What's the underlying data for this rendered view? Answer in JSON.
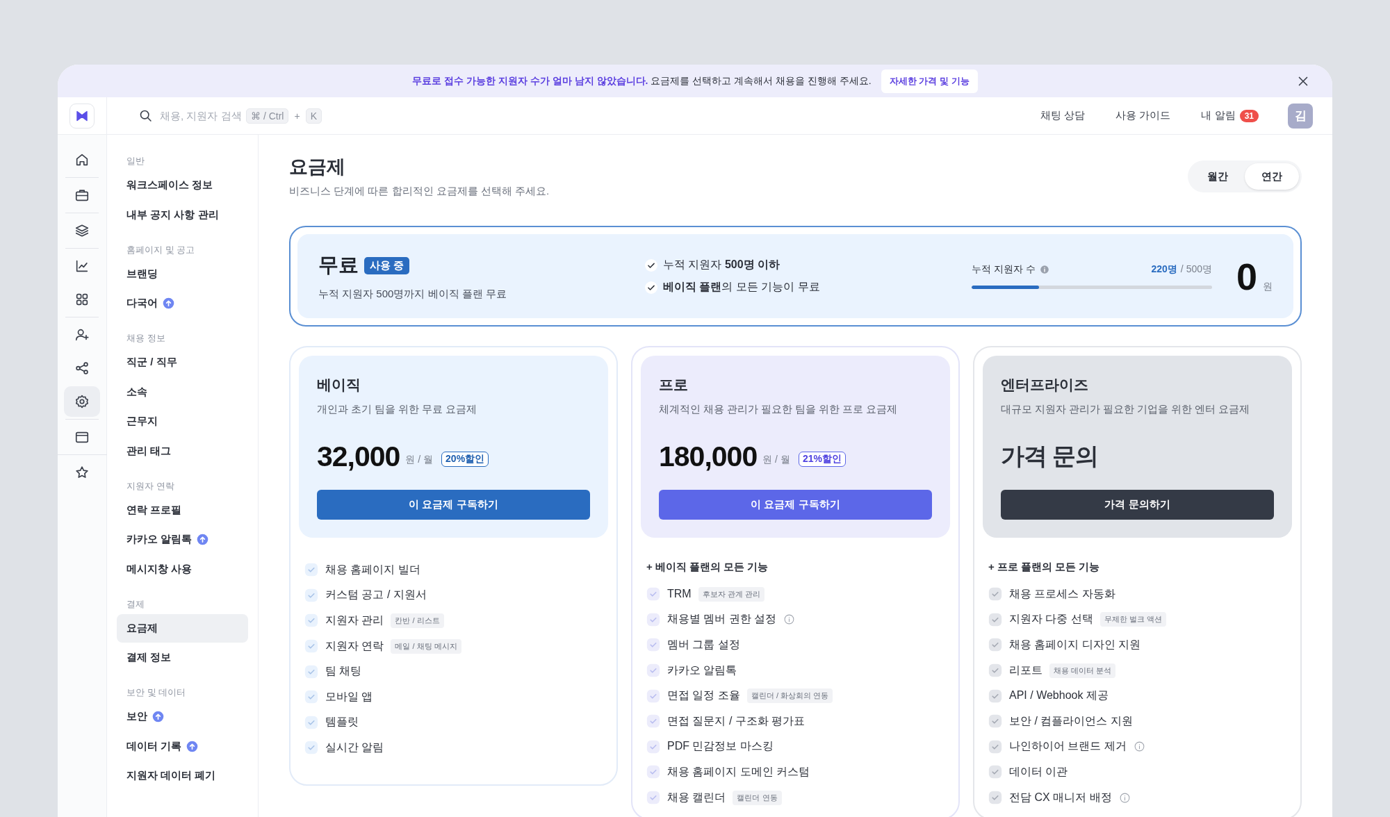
{
  "banner": {
    "message": "**무료로 접수 가능한 지원자 수가 얼마 남지 않았습니다.** 요금제를 선택하고 계속해서 채용을 진행해 주세요.",
    "link": "자세한 가격 및 기능"
  },
  "topbar": {
    "search": {
      "placeholder": "채용, 지원자 검색",
      "keys": [
        "⌘ / Ctrl",
        "K"
      ],
      "joiner": "+"
    },
    "links": [
      {
        "label": "채팅 상담"
      },
      {
        "label": "사용 가이드"
      },
      {
        "label": "내 알림",
        "badge": "31"
      }
    ],
    "avatar": "김"
  },
  "rail": [
    [
      {
        "kind": "home",
        "selected": false
      }
    ],
    [
      {
        "kind": "briefcase",
        "selected": false
      }
    ],
    [
      {
        "kind": "layers",
        "selected": false
      }
    ],
    [
      {
        "kind": "chart",
        "selected": false
      },
      {
        "kind": "grid",
        "selected": false
      }
    ],
    [
      {
        "kind": "user-plus",
        "selected": false
      },
      {
        "kind": "share",
        "selected": false
      },
      {
        "kind": "settings",
        "selected": true
      }
    ],
    [
      {
        "kind": "window",
        "selected": false
      }
    ],
    [
      {
        "kind": "star",
        "selected": false
      }
    ]
  ],
  "sidebar": [
    {
      "title": "일반",
      "items": [
        {
          "label": "워크스페이스 정보",
          "selected": false,
          "upgrade": false
        },
        {
          "label": "내부 공지 사항 관리",
          "selected": false,
          "upgrade": false
        }
      ]
    },
    {
      "title": "홈페이지 및 공고",
      "items": [
        {
          "label": "브랜딩",
          "selected": false,
          "upgrade": false
        },
        {
          "label": "다국어",
          "selected": false,
          "upgrade": true
        }
      ]
    },
    {
      "title": "채용 정보",
      "items": [
        {
          "label": "직군 / 직무",
          "selected": false,
          "upgrade": false
        },
        {
          "label": "소속",
          "selected": false,
          "upgrade": false
        },
        {
          "label": "근무지",
          "selected": false,
          "upgrade": false
        },
        {
          "label": "관리 태그",
          "selected": false,
          "upgrade": false
        }
      ]
    },
    {
      "title": "지원자 연락",
      "items": [
        {
          "label": "연락 프로필",
          "selected": false,
          "upgrade": false
        },
        {
          "label": "카카오 알림톡",
          "selected": false,
          "upgrade": true
        },
        {
          "label": "메시지창 사용",
          "selected": false,
          "upgrade": false
        }
      ]
    },
    {
      "title": "결제",
      "items": [
        {
          "label": "요금제",
          "selected": true,
          "upgrade": false
        },
        {
          "label": "결제 정보",
          "selected": false,
          "upgrade": false
        }
      ]
    },
    {
      "title": "보안 및 데이터",
      "items": [
        {
          "label": "보안",
          "selected": false,
          "upgrade": true
        },
        {
          "label": "데이터 기록",
          "selected": false,
          "upgrade": true
        },
        {
          "label": "지원자 데이터 폐기",
          "selected": false,
          "upgrade": false
        }
      ]
    }
  ],
  "page": {
    "title": "요금제",
    "subtitle": "비즈니스 단계에 따른 합리적인 요금제를 선택해 주세요.",
    "billing": [
      {
        "label": "월간",
        "selected": false
      },
      {
        "label": "연간",
        "selected": true
      }
    ]
  },
  "current_plan": {
    "name": "무료",
    "badge": "사용 중",
    "description": "누적 지원자 500명까지 베이직 플랜 무료",
    "features": [
      "누적 지원자 **500명 이하**",
      "**베이직 플랜**의 모든 기능이 무료"
    ],
    "usage": {
      "label": "누적 지원자 수",
      "current": "220명",
      "limit": "/ 500명",
      "level": 0.28
    },
    "price": "0",
    "unit": "원"
  },
  "plans": [
    {
      "kind": "basic",
      "name": "베이직",
      "description": "개인과 초기 팀을 위한 무료 요금제",
      "price": "32,000",
      "unit": "원 / 월",
      "discount": "20%할인",
      "button": "이 요금제 구독하기",
      "features": [
        {
          "text": "채용 홈페이지 빌더"
        },
        {
          "text": "커스텀 공고 / 지원서"
        },
        {
          "text": "지원자 관리",
          "tag": "칸반 / 리스트"
        },
        {
          "text": "지원자 연락",
          "tag": "메일 / 채팅 메시지"
        },
        {
          "text": "팀 채팅"
        },
        {
          "text": "모바일 앱"
        },
        {
          "text": "템플릿"
        },
        {
          "text": "실시간 알림"
        }
      ]
    },
    {
      "kind": "pro",
      "name": "프로",
      "description": "체계적인 채용 관리가 필요한 팀을 위한 프로 요금제",
      "price": "180,000",
      "unit": "원 / 월",
      "discount": "21%할인",
      "button": "이 요금제 구독하기",
      "includes": "+ 베이직 플랜의 모든 기능",
      "features": [
        {
          "text": "TRM",
          "tag": "후보자 관계 관리"
        },
        {
          "text": "채용별 멤버 권한 설정",
          "info": true
        },
        {
          "text": "멤버 그룹 설정"
        },
        {
          "text": "카카오 알림톡"
        },
        {
          "text": "면접 일정 조율",
          "tag": "캘린더 / 화상회의 연동"
        },
        {
          "text": "면접 질문지 / 구조화 평가표"
        },
        {
          "text": "PDF 민감정보 마스킹"
        },
        {
          "text": "채용 홈페이지 도메인 커스텀"
        },
        {
          "text": "채용 캘린더",
          "tag": "캘린더 연동"
        }
      ]
    },
    {
      "kind": "enterprise",
      "name": "엔터프라이즈",
      "description": "대규모 지원자 관리가 필요한 기업을 위한 엔터 요금제",
      "price": "가격 문의",
      "button": "가격 문의하기",
      "includes": "+ 프로 플랜의 모든 기능",
      "features": [
        {
          "text": "채용 프로세스 자동화"
        },
        {
          "text": "지원자 다중 선택",
          "tag": "무제한 벌크 액션"
        },
        {
          "text": "채용 홈페이지 디자인 지원"
        },
        {
          "text": "리포트",
          "tag": "채용 데이터 분석"
        },
        {
          "text": "API / Webhook 제공"
        },
        {
          "text": "보안 / 컴플라이언스 지원"
        },
        {
          "text": "나인하이어 브랜드 제거",
          "info": true
        },
        {
          "text": "데이터 이관"
        },
        {
          "text": "전담 CX 매니저 배정",
          "info": true
        }
      ]
    }
  ]
}
